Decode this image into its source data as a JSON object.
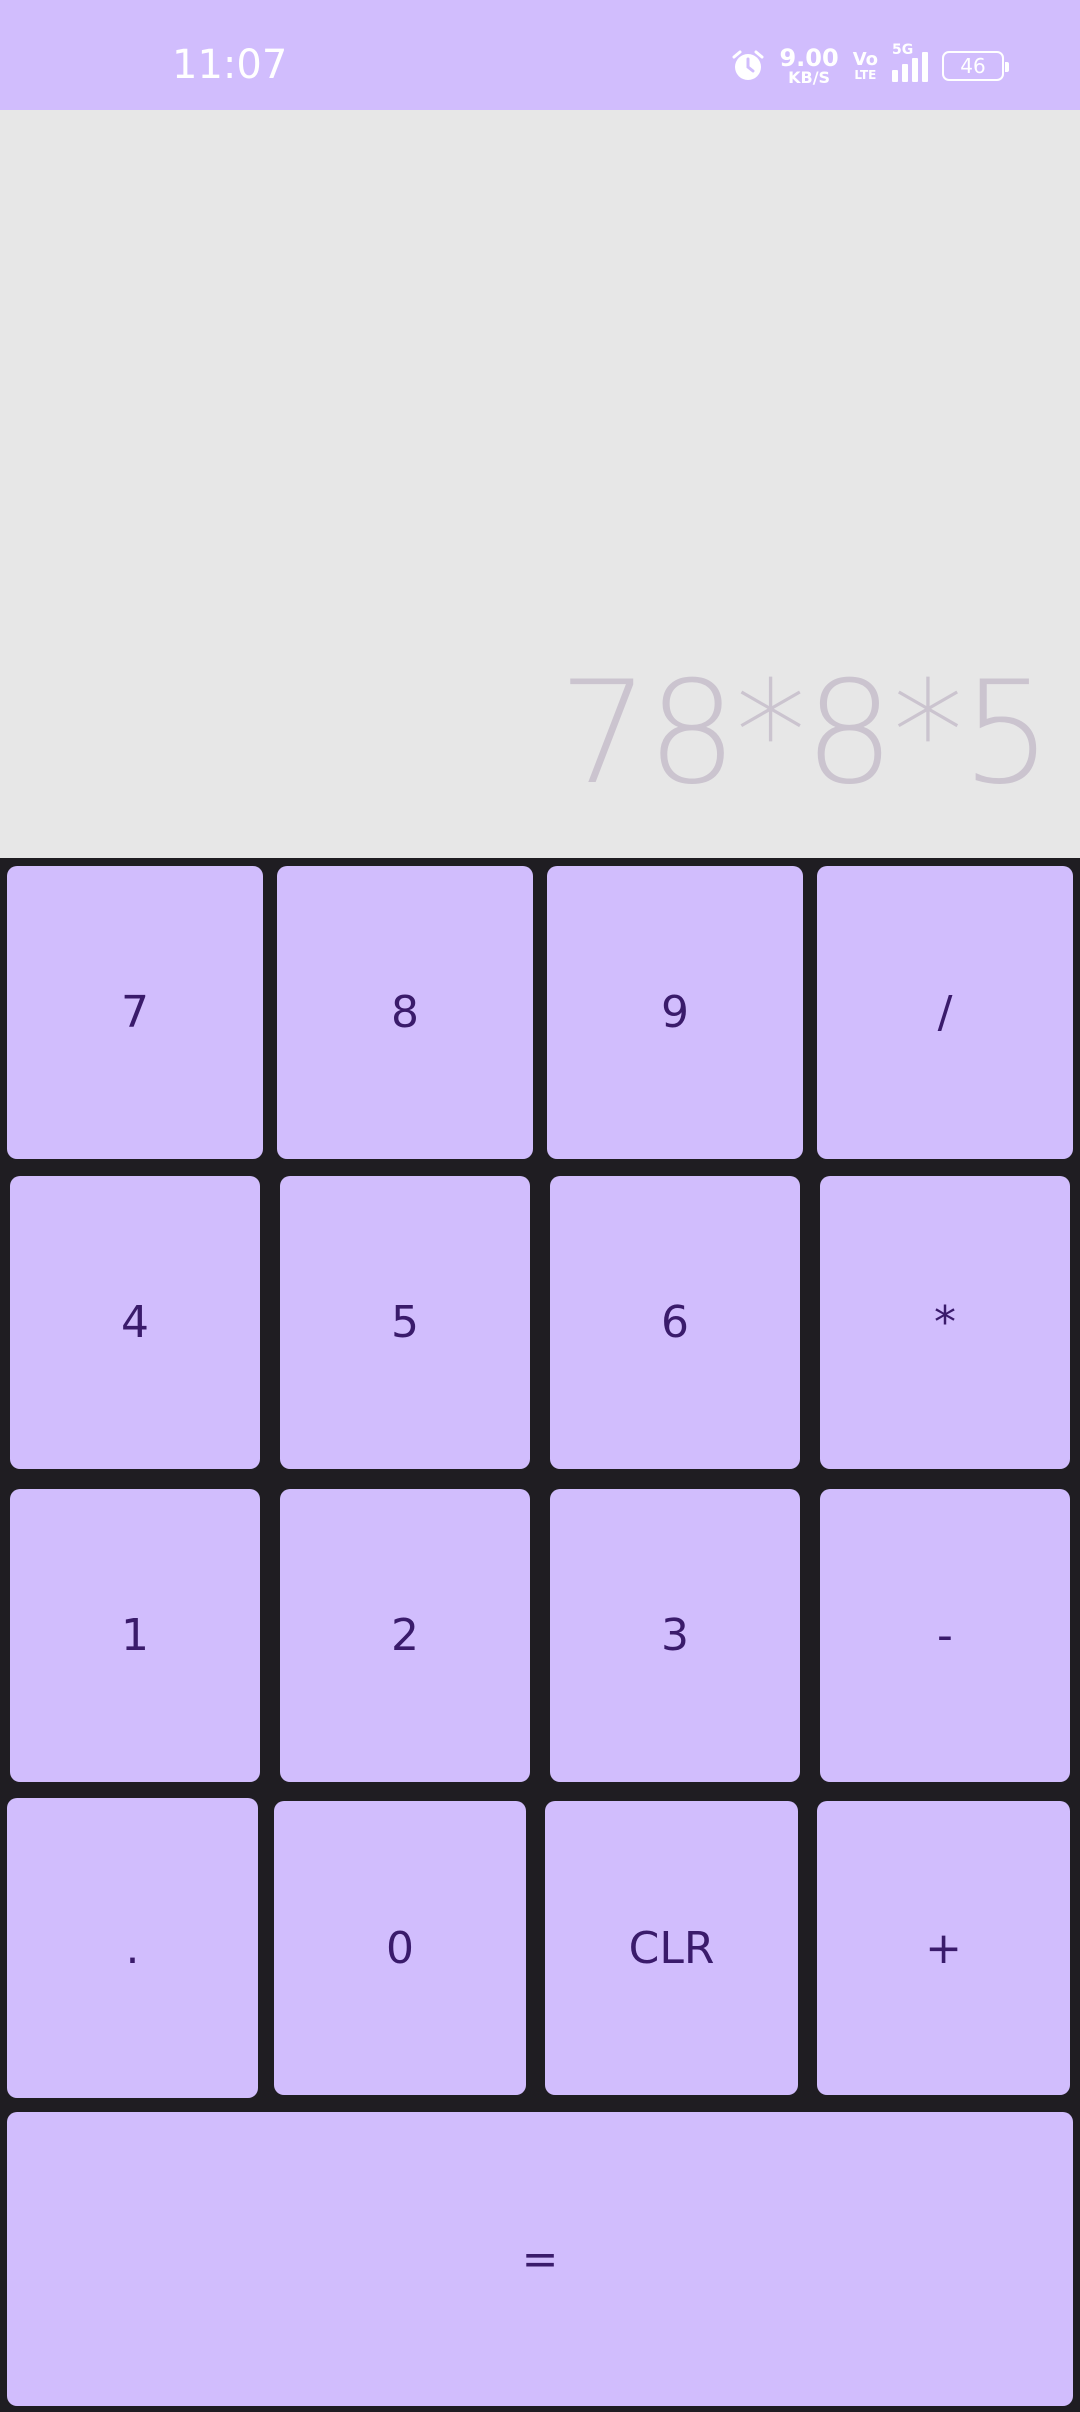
{
  "status_bar": {
    "time": "11:07",
    "net_speed_value": "9.00",
    "net_speed_unit": "KB/S",
    "volte_top": "Vo",
    "volte_bottom": "LTE",
    "network_type": "5G",
    "battery_level": "46"
  },
  "display": {
    "expression": "78*8*5"
  },
  "keypad": {
    "k7": "7",
    "k8": "8",
    "k9": "9",
    "kdiv": "/",
    "k4": "4",
    "k5": "5",
    "k6": "6",
    "kmul": "*",
    "k1": "1",
    "k2": "2",
    "k3": "3",
    "ksub": "-",
    "kdot": ".",
    "k0": "0",
    "kclr": "CLR",
    "kadd": "+",
    "keq": "="
  },
  "colors": {
    "accent": "#d1bdfd",
    "key_text": "#3a1b6b",
    "display_bg": "#e7e7e7",
    "expression_text": "#cbc4cf",
    "keypad_bg": "#1f1d22"
  }
}
